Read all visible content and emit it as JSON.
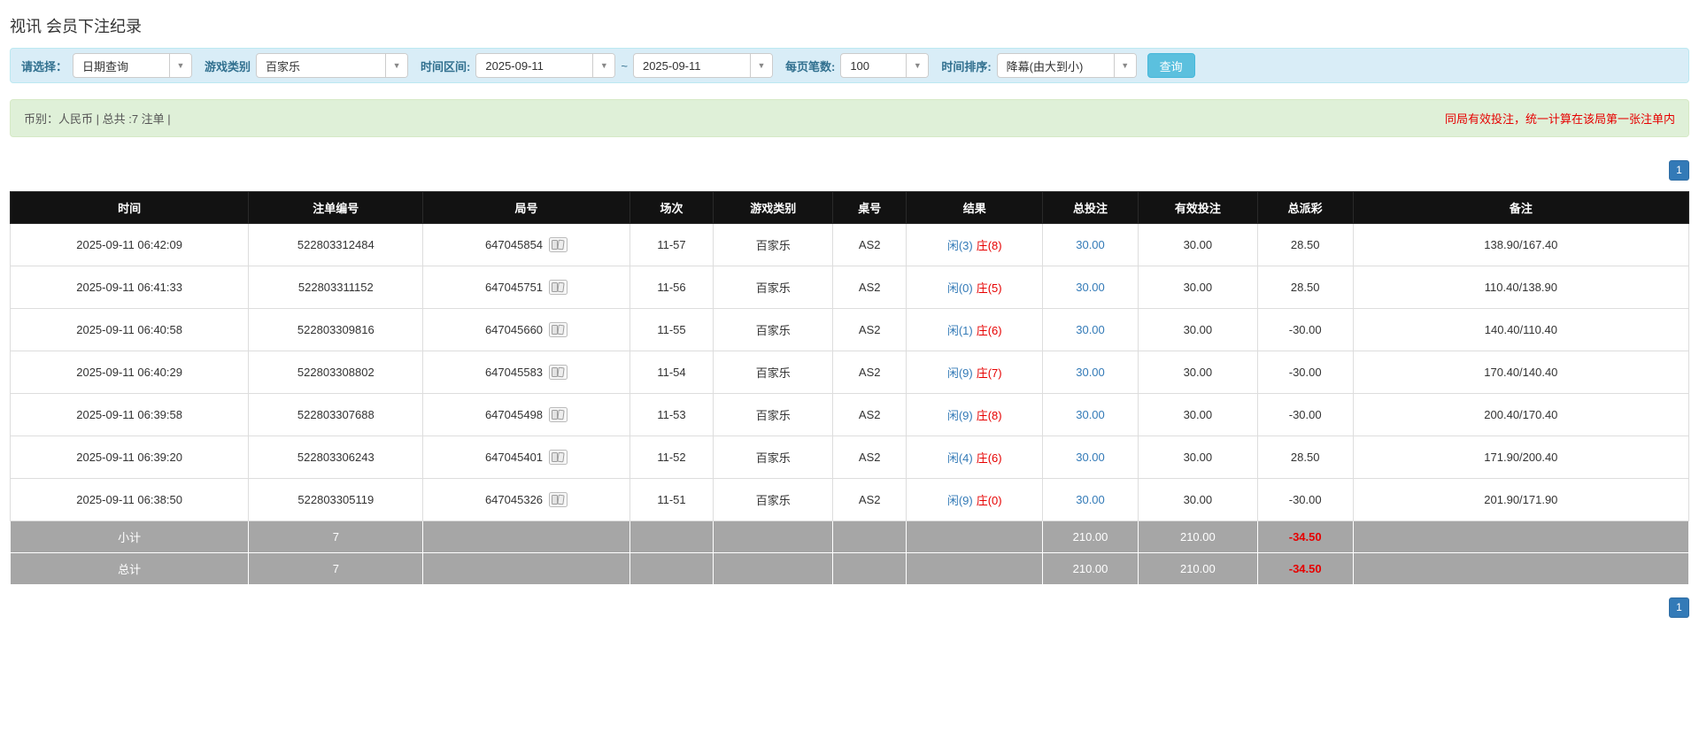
{
  "page": {
    "title": "视讯 会员下注纪录"
  },
  "colors": {
    "link_blue": "#337ab7",
    "banker_red": "#e60000",
    "negative_red": "#e60000",
    "header_bg": "#121212",
    "summary_row_bg": "#a6a6a6",
    "filter_bar_bg": "#d9edf7",
    "success_bar_bg": "#dff0d8",
    "search_button_bg": "#5bc0de",
    "pager_bg": "#337ab7"
  },
  "filters": {
    "select_label": "请选择：",
    "select_value": "日期查询",
    "game_type_label": "游戏类别",
    "game_type_value": "百家乐",
    "date_range_label": "时间区间:",
    "date_from": "2025-09-11",
    "range_separator": "~",
    "date_to": "2025-09-11",
    "page_size_label": "每页笔数:",
    "page_size_value": "100",
    "sort_label": "时间排序:",
    "sort_value": "降幕(由大到小)",
    "search_button": "查询"
  },
  "summary_bar": {
    "left_text": "币别：人民币 | 总共 :7 注单 |",
    "right_text": "同局有效投注，统一计算在该局第一张注单内"
  },
  "pagination": {
    "page": "1"
  },
  "table": {
    "headers": [
      "时间",
      "注单编号",
      "局号",
      "场次",
      "游戏类别",
      "桌号",
      "结果",
      "总投注",
      "有效投注",
      "总派彩",
      "备注"
    ],
    "rows": [
      {
        "time": "2025-09-11 06:42:09",
        "bet_id": "522803312484",
        "round_id": "647045854",
        "session": "11-57",
        "game": "百家乐",
        "table_no": "AS2",
        "result_player": "闲(3)",
        "result_banker": "庄(8)",
        "total_bet": "30.00",
        "valid_bet": "30.00",
        "payout": "28.50",
        "remark": "138.90/167.40"
      },
      {
        "time": "2025-09-11 06:41:33",
        "bet_id": "522803311152",
        "round_id": "647045751",
        "session": "11-56",
        "game": "百家乐",
        "table_no": "AS2",
        "result_player": "闲(0)",
        "result_banker": "庄(5)",
        "total_bet": "30.00",
        "valid_bet": "30.00",
        "payout": "28.50",
        "remark": "110.40/138.90"
      },
      {
        "time": "2025-09-11 06:40:58",
        "bet_id": "522803309816",
        "round_id": "647045660",
        "session": "11-55",
        "game": "百家乐",
        "table_no": "AS2",
        "result_player": "闲(1)",
        "result_banker": "庄(6)",
        "total_bet": "30.00",
        "valid_bet": "30.00",
        "payout": "-30.00",
        "remark": "140.40/110.40"
      },
      {
        "time": "2025-09-11 06:40:29",
        "bet_id": "522803308802",
        "round_id": "647045583",
        "session": "11-54",
        "game": "百家乐",
        "table_no": "AS2",
        "result_player": "闲(9)",
        "result_banker": "庄(7)",
        "total_bet": "30.00",
        "valid_bet": "30.00",
        "payout": "-30.00",
        "remark": "170.40/140.40"
      },
      {
        "time": "2025-09-11 06:39:58",
        "bet_id": "522803307688",
        "round_id": "647045498",
        "session": "11-53",
        "game": "百家乐",
        "table_no": "AS2",
        "result_player": "闲(9)",
        "result_banker": "庄(8)",
        "total_bet": "30.00",
        "valid_bet": "30.00",
        "payout": "-30.00",
        "remark": "200.40/170.40"
      },
      {
        "time": "2025-09-11 06:39:20",
        "bet_id": "522803306243",
        "round_id": "647045401",
        "session": "11-52",
        "game": "百家乐",
        "table_no": "AS2",
        "result_player": "闲(4)",
        "result_banker": "庄(6)",
        "total_bet": "30.00",
        "valid_bet": "30.00",
        "payout": "28.50",
        "remark": "171.90/200.40"
      },
      {
        "time": "2025-09-11 06:38:50",
        "bet_id": "522803305119",
        "round_id": "647045326",
        "session": "11-51",
        "game": "百家乐",
        "table_no": "AS2",
        "result_player": "闲(9)",
        "result_banker": "庄(0)",
        "total_bet": "30.00",
        "valid_bet": "30.00",
        "payout": "-30.00",
        "remark": "201.90/171.90"
      }
    ],
    "subtotal": {
      "label": "小计",
      "count": "7",
      "total_bet": "210.00",
      "valid_bet": "210.00",
      "payout": "-34.50"
    },
    "total": {
      "label": "总计",
      "count": "7",
      "total_bet": "210.00",
      "valid_bet": "210.00",
      "payout": "-34.50"
    }
  }
}
